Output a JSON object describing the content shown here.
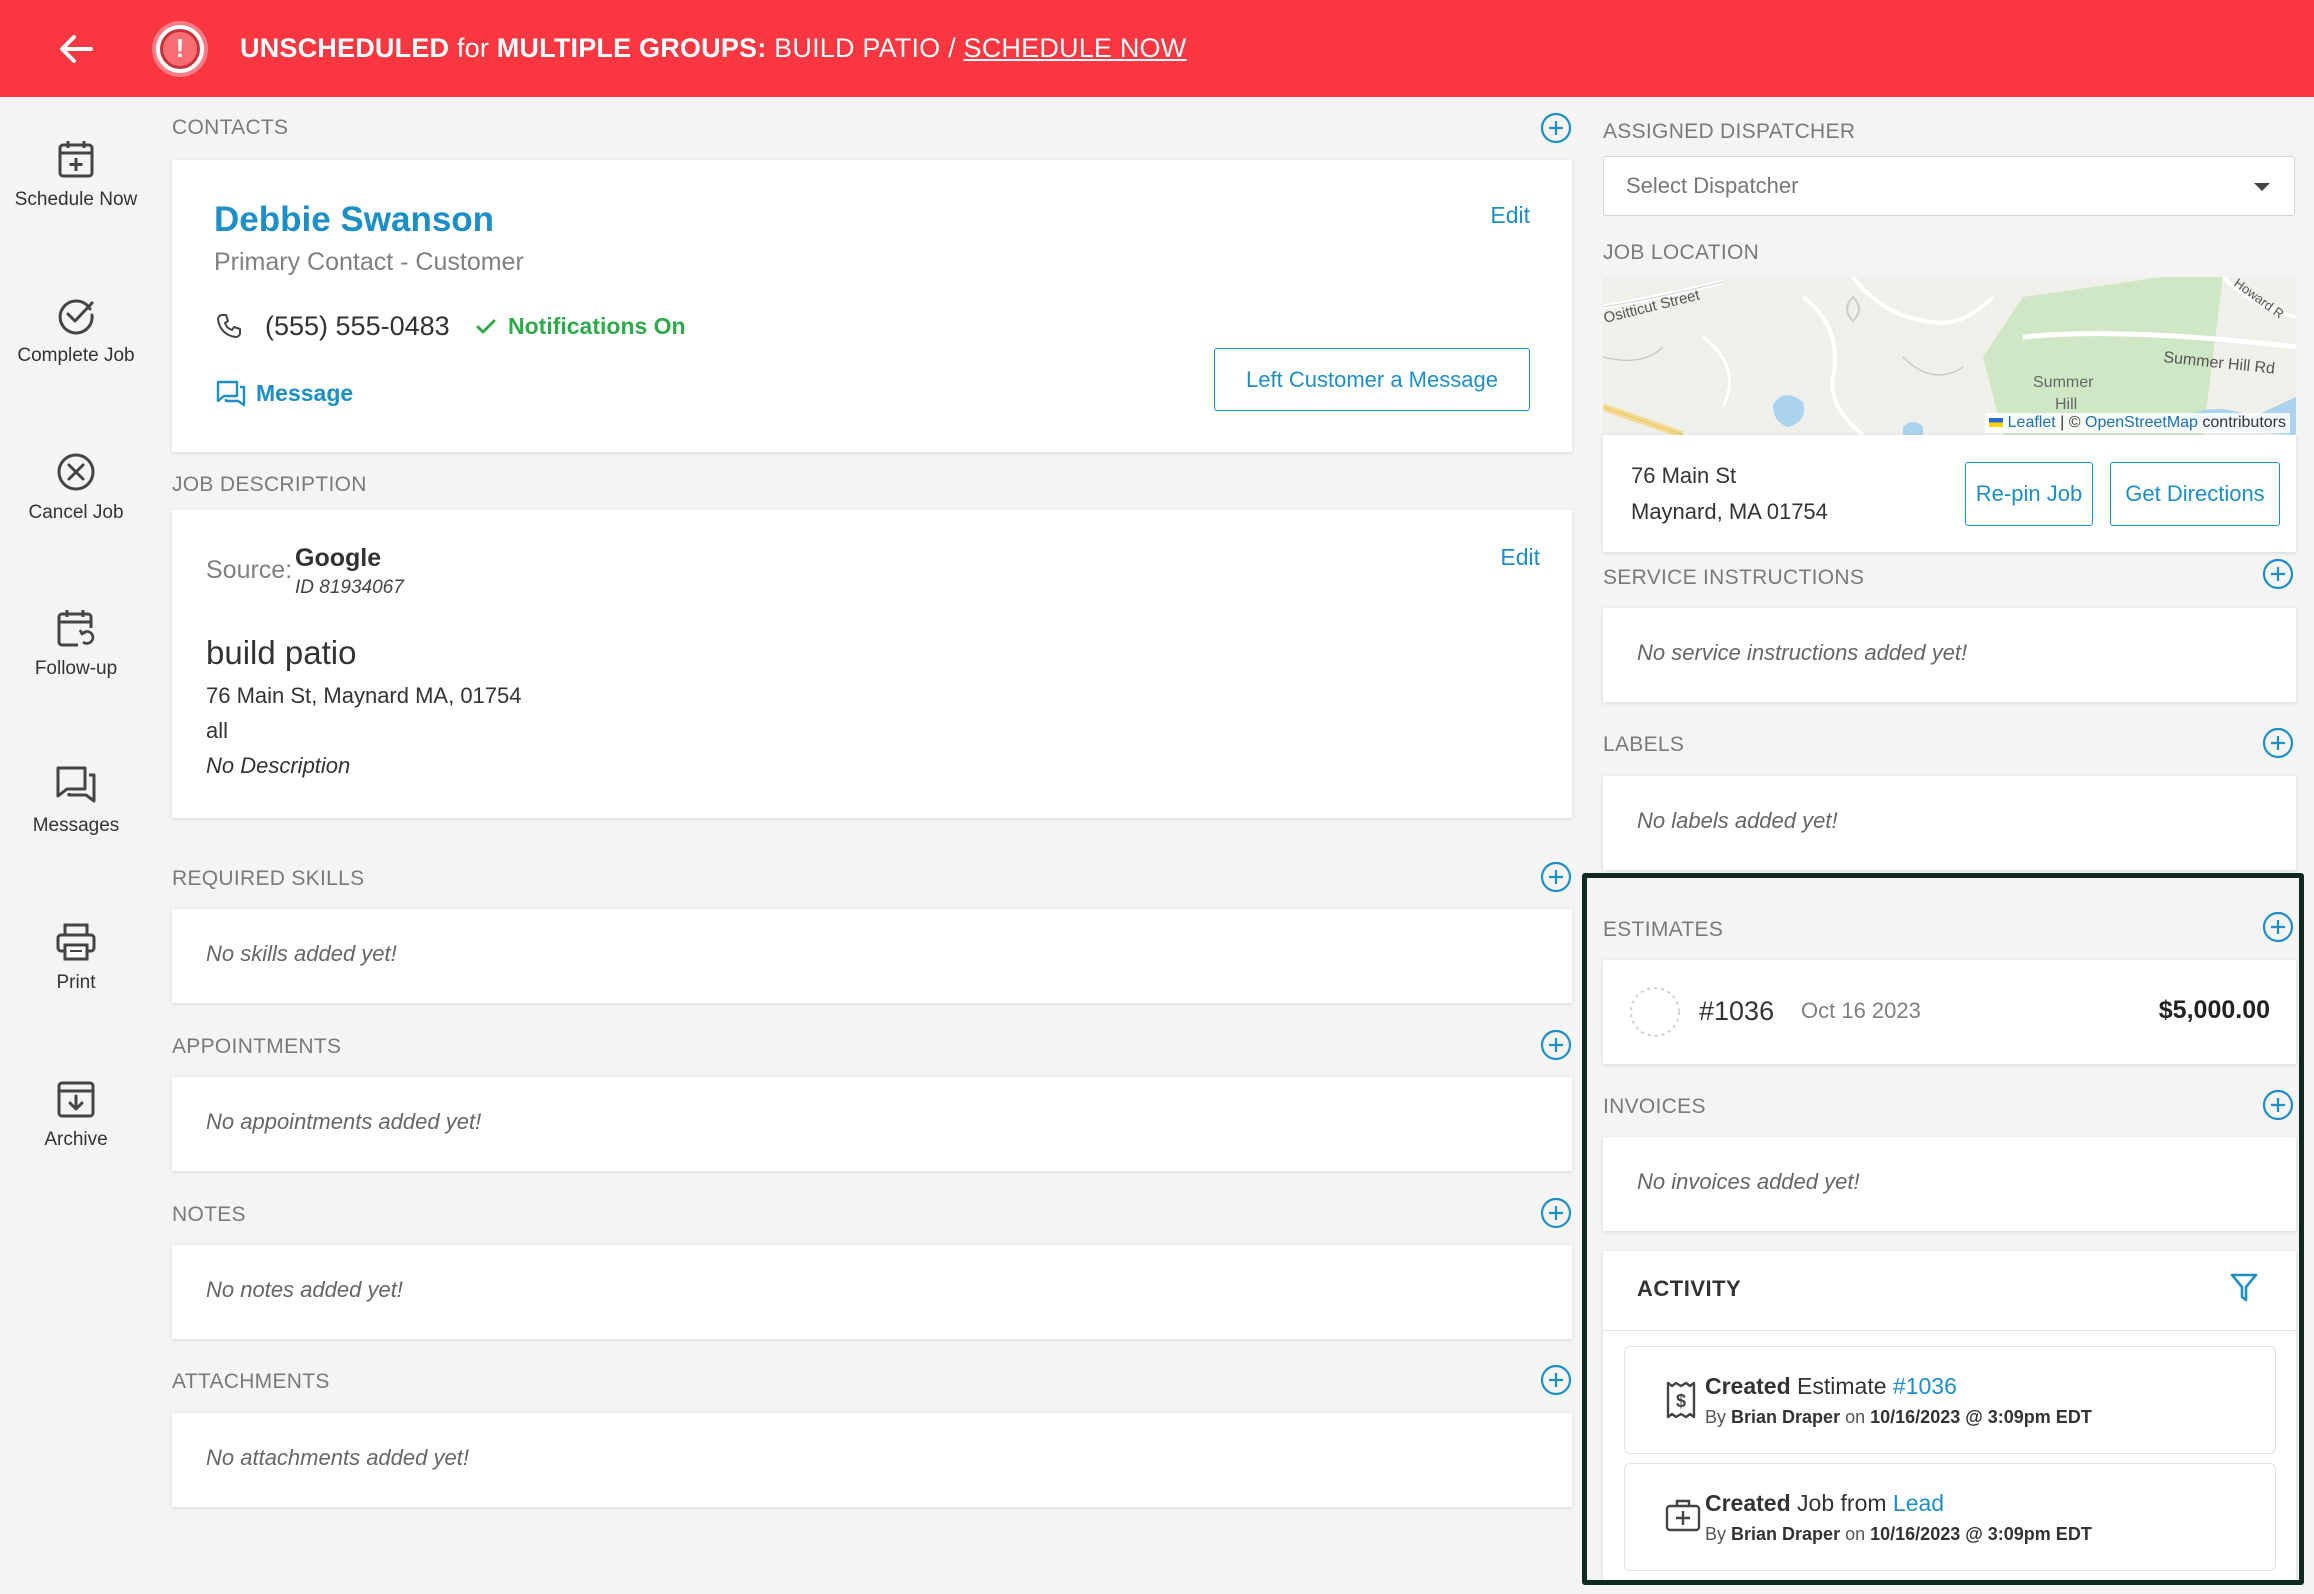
{
  "banner": {
    "status": "UNSCHEDULED",
    "for_word": "for",
    "groups": "MULTIPLE GROUPS",
    "colon": ":",
    "job_name": "BUILD PATIO",
    "slash": "/",
    "schedule_link": "SCHEDULE NOW",
    "color": "#fa3641"
  },
  "rail": {
    "items": [
      {
        "label": "Schedule Now",
        "icon": "calendar-plus-icon"
      },
      {
        "label": "Complete Job",
        "icon": "check-circle-icon"
      },
      {
        "label": "Cancel Job",
        "icon": "x-circle-icon"
      },
      {
        "label": "Follow-up",
        "icon": "calendar-refresh-icon"
      },
      {
        "label": "Messages",
        "icon": "chat-icon"
      },
      {
        "label": "Print",
        "icon": "printer-icon"
      },
      {
        "label": "Archive",
        "icon": "archive-icon"
      }
    ]
  },
  "contacts": {
    "label": "CONTACTS",
    "name": "Debbie Swanson",
    "role": "Primary Contact - Customer",
    "edit": "Edit",
    "phone": "(555) 555-0483",
    "notifications": "Notifications On",
    "message_link": "Message",
    "left_message_button": "Left Customer a Message"
  },
  "job_description": {
    "label": "JOB DESCRIPTION",
    "source_label": "Source:",
    "source": "Google",
    "source_id": "ID 81934067",
    "edit": "Edit",
    "title": "build patio",
    "address": "76 Main St, Maynard MA, 01754",
    "scope": "all",
    "description": "No Description"
  },
  "required_skills": {
    "label": "REQUIRED SKILLS",
    "empty": "No skills added yet!"
  },
  "appointments": {
    "label": "APPOINTMENTS",
    "empty": "No appointments added yet!"
  },
  "notes": {
    "label": "NOTES",
    "empty": "No notes added yet!"
  },
  "attachments": {
    "label": "ATTACHMENTS",
    "empty": "No attachments added yet!"
  },
  "dispatcher": {
    "label": "ASSIGNED DISPATCHER",
    "placeholder": "Select Dispatcher"
  },
  "job_location": {
    "label": "JOB LOCATION",
    "map_labels": {
      "street1": "Ositticut Street",
      "street2": "Summer Hill Rd",
      "street3": "Howard R",
      "place": "Summer",
      "place2": "Hill"
    },
    "attribution_leaflet": "Leaflet",
    "attribution_sep": "| ©",
    "attribution_osm": "OpenStreetMap",
    "attribution_tail": "contributors",
    "address_line1": "76 Main St",
    "address_line2": "Maynard, MA 01754",
    "repin_button": "Re-pin Job",
    "directions_button": "Get Directions"
  },
  "service_instructions": {
    "label": "SERVICE INSTRUCTIONS",
    "empty": "No service instructions added yet!"
  },
  "labels": {
    "label": "LABELS",
    "empty": "No labels added yet!"
  },
  "estimates": {
    "label": "ESTIMATES",
    "items": [
      {
        "number": "#1036",
        "date": "Oct 16 2023",
        "amount": "$5,000.00"
      }
    ]
  },
  "invoices": {
    "label": "INVOICES",
    "empty": "No invoices added yet!"
  },
  "activity": {
    "label": "ACTIVITY",
    "items": [
      {
        "verb": "Created",
        "object": "Estimate",
        "link": "#1036",
        "by": "By",
        "user": "Brian Draper",
        "on": "on",
        "when": "10/16/2023 @ 3:09pm EDT",
        "icon": "receipt-dollar-icon"
      },
      {
        "verb": "Created",
        "object": "Job from",
        "link": "Lead",
        "by": "By",
        "user": "Brian Draper",
        "on": "on",
        "when": "10/16/2023 @ 3:09pm EDT",
        "icon": "briefcase-plus-icon"
      }
    ]
  },
  "colors": {
    "accent": "#1d8fc8",
    "success": "#2eaa4a",
    "highlight_border": "#0f2a22"
  }
}
